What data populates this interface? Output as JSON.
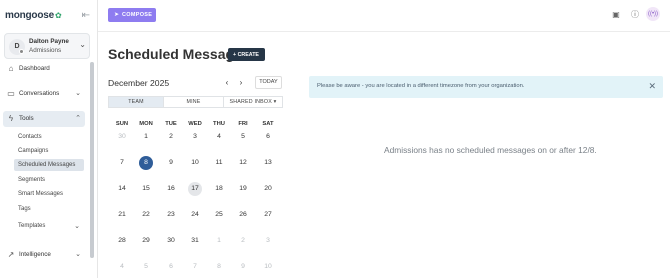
{
  "app": {
    "logo": "mongoose",
    "compose_label": "COMPOSE"
  },
  "user": {
    "initial": "D",
    "name": "Dalton Payne",
    "department": "Admissions"
  },
  "sidebar": {
    "items": [
      {
        "label": "Dashboard",
        "icon": "home-icon"
      },
      {
        "label": "Conversations",
        "icon": "chat-icon"
      },
      {
        "label": "Tools",
        "icon": "bolt-icon"
      }
    ],
    "tools_sub": [
      {
        "label": "Contacts"
      },
      {
        "label": "Campaigns"
      },
      {
        "label": "Scheduled Messages"
      },
      {
        "label": "Segments"
      },
      {
        "label": "Smart Messages"
      },
      {
        "label": "Tags"
      },
      {
        "label": "Templates"
      }
    ],
    "intelligence": {
      "label": "Intelligence",
      "icon": "chart-icon"
    }
  },
  "page": {
    "title": "Scheduled Messages",
    "create_label": "CREATE"
  },
  "calendar": {
    "month_label": "December 2025",
    "today_label": "TODAY",
    "tabs": [
      "TEAM",
      "MINE",
      "SHARED INBOX"
    ],
    "active_tab": "TEAM",
    "weekdays": [
      "SUN",
      "MON",
      "TUE",
      "WED",
      "THU",
      "FRI",
      "SAT"
    ],
    "weeks": [
      [
        "30",
        "1",
        "2",
        "3",
        "4",
        "5",
        "6"
      ],
      [
        "7",
        "8",
        "9",
        "10",
        "11",
        "12",
        "13"
      ],
      [
        "14",
        "15",
        "16",
        "17",
        "18",
        "19",
        "20"
      ],
      [
        "21",
        "22",
        "23",
        "24",
        "25",
        "26",
        "27"
      ],
      [
        "28",
        "29",
        "30",
        "31",
        "1",
        "2",
        "3"
      ],
      [
        "4",
        "5",
        "6",
        "7",
        "8",
        "9",
        "10"
      ]
    ],
    "selected_day": "8",
    "highlighted_day": "17"
  },
  "notice": {
    "message": "Please be aware - you are located in a different timezone from your organization."
  },
  "empty_state": "Admissions has no scheduled messages on or after 12/8.",
  "colors": {
    "compose": "#8e7cf0",
    "create": "#263647",
    "today": "#2f5d99",
    "notice_bg": "#e2f3f8"
  }
}
